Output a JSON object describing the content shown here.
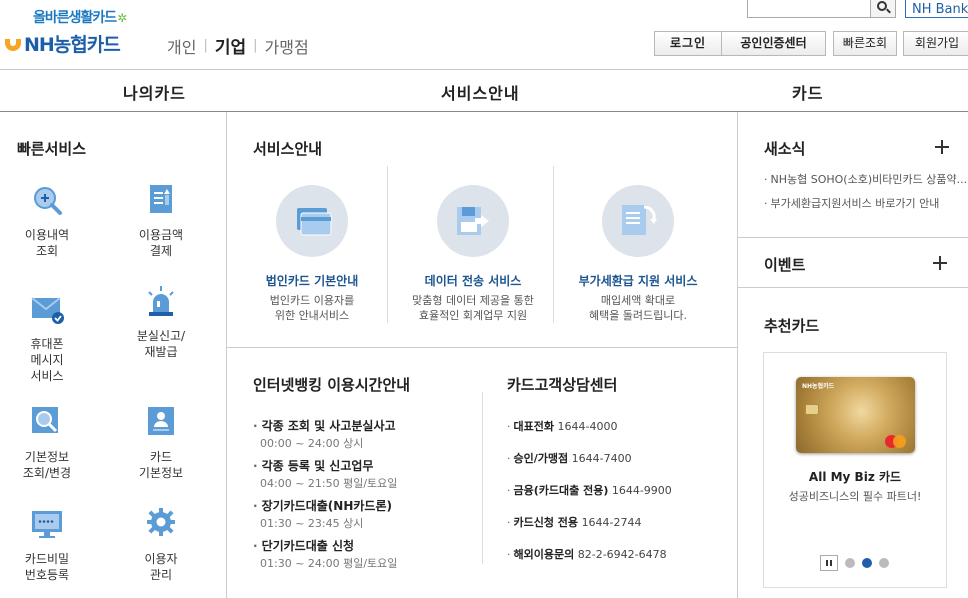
{
  "header": {
    "slogan": "올바른생활카드",
    "logo": "NH농협카드",
    "nav": [
      {
        "label": "개인"
      },
      {
        "label": "기업"
      },
      {
        "label": "가맹점"
      }
    ],
    "search": {
      "value": "",
      "placeholder": ""
    },
    "nhbank_label": "NH Bank",
    "util": {
      "login": "로그인",
      "cert": "공인인증센터",
      "quick": "빠른조회",
      "join": "회원가입"
    }
  },
  "menu": {
    "mycard": "나의카드",
    "service": "서비스안내",
    "card": "카드"
  },
  "quick_services": {
    "title": "빠른서비스",
    "items": [
      {
        "line1": "이용내역",
        "line2": "조회",
        "line3": ""
      },
      {
        "line1": "이용금액",
        "line2": "결제",
        "line3": ""
      },
      {
        "line1": "휴대폰",
        "line2": "메시지",
        "line3": "서비스"
      },
      {
        "line1": "분실신고/",
        "line2": "재발급",
        "line3": ""
      },
      {
        "line1": "기본정보",
        "line2": "조회/변경",
        "line3": ""
      },
      {
        "line1": "카드",
        "line2": "기본정보",
        "line3": ""
      },
      {
        "line1": "카드비밀",
        "line2": "번호등록",
        "line3": ""
      },
      {
        "line1": "이용자",
        "line2": "관리",
        "line3": ""
      }
    ]
  },
  "service_info": {
    "title": "서비스안내",
    "cards": [
      {
        "title": "법인카드 기본안내",
        "desc1": "법인카드 이용자를",
        "desc2": "위한 안내서비스"
      },
      {
        "title": "데이터 전송 서비스",
        "desc1": "맞춤형 데이터 제공을 통한",
        "desc2": "효율적인 회계업무 지원"
      },
      {
        "title": "부가세환급 지원 서비스",
        "desc1": "매입세액 확대로",
        "desc2": "혜택을 돌려드립니다."
      }
    ]
  },
  "banking_hours": {
    "title": "인터넷뱅킹 이용시간안내",
    "items": [
      {
        "title": "각종 조회 및 사고분실사고",
        "time": "00:00 ~ 24:00 상시"
      },
      {
        "title": "각종 등록 및 신고업무",
        "time": "04:00 ~ 21:50 평일/토요일"
      },
      {
        "title": "장기카드대출(NH카드론)",
        "time": "01:30 ~ 23:45 상시"
      },
      {
        "title": "단기카드대출 신청",
        "time": "01:30 ~ 24:00 평일/토요일"
      }
    ]
  },
  "call_center": {
    "title": "카드고객상담센터",
    "items": [
      {
        "label": "대표전화",
        "number": "1644-4000"
      },
      {
        "label": "승인/가맹점",
        "number": "1644-7400"
      },
      {
        "label": "금융(카드대출 전용)",
        "number": "1644-9900"
      },
      {
        "label": "카드신청 전용",
        "number": "1644-2744"
      },
      {
        "label": "해외이용문의",
        "number": "82-2-6942-6478"
      }
    ]
  },
  "right": {
    "news_title": "새소식",
    "news": [
      {
        "text": "NH농협 SOHO(소호)비타민카드 상품약..."
      },
      {
        "text": "부가세환급지원서비스 바로가기 안내"
      }
    ],
    "event_title": "이벤트",
    "recommend_title": "추천카드",
    "card": {
      "brand": "NH농협카드",
      "name": "All My Biz 카드",
      "desc": "성공비즈니스의 필수 파트너!"
    },
    "carousel": {
      "total": 3,
      "active": 2
    }
  }
}
